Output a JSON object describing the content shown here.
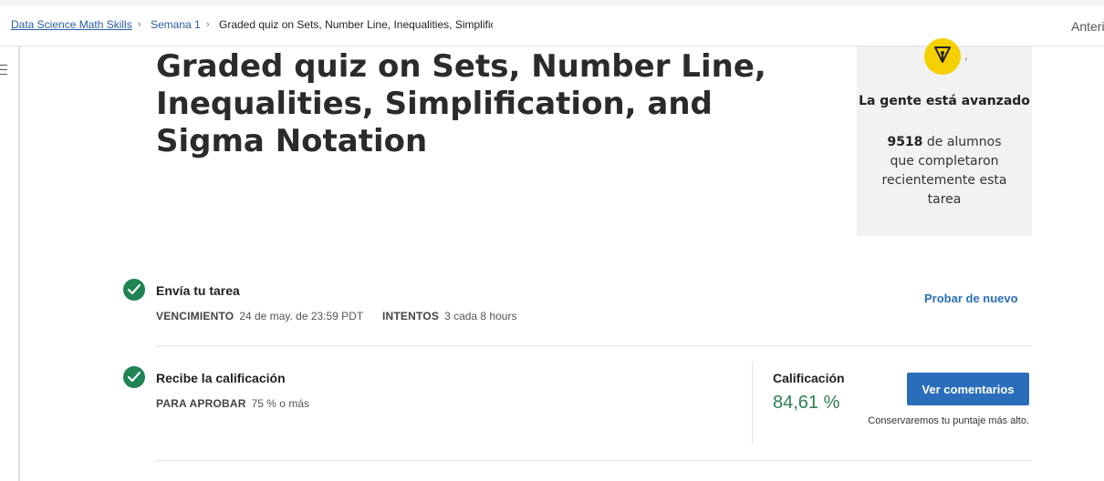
{
  "breadcrumb": {
    "course": "Data Science Math Skills",
    "week": "Semana 1",
    "current": "Graded quiz on Sets, Number Line, Inequalities, Simplification, and Sigma Notation"
  },
  "nav": {
    "previous": "Anterior"
  },
  "page_title": "Graded quiz on Sets, Number Line, Inequalities, Simplification, and Sigma Notation",
  "stats": {
    "comma": ",",
    "heading": "La gente está avanzado",
    "count": "9518",
    "text": " de alumnos que completaron recientemente esta tarea"
  },
  "submit_step": {
    "title": "Envía tu tarea",
    "due_label": "VENCIMIENTO",
    "due_value": "24 de may. de 23:59 PDT",
    "attempts_label": "INTENTOS",
    "attempts_value": "3 cada 8 hours",
    "retry": "Probar de nuevo"
  },
  "grade_step": {
    "title": "Recibe la calificación",
    "pass_label": "PARA APROBAR",
    "pass_value": "75 % o más",
    "grade_label": "Calificación",
    "grade_value": "84,61 %",
    "view_feedback": "Ver comentarios",
    "keep_note": "Conservaremos tu puntaje más alto."
  },
  "colors": {
    "accent": "#2a6ebb",
    "success": "#1f8354",
    "badge": "#f5d000"
  },
  "icons": [
    "menu-icon",
    "chevron-right-icon",
    "pen-nib-icon",
    "checkmark-icon"
  ]
}
